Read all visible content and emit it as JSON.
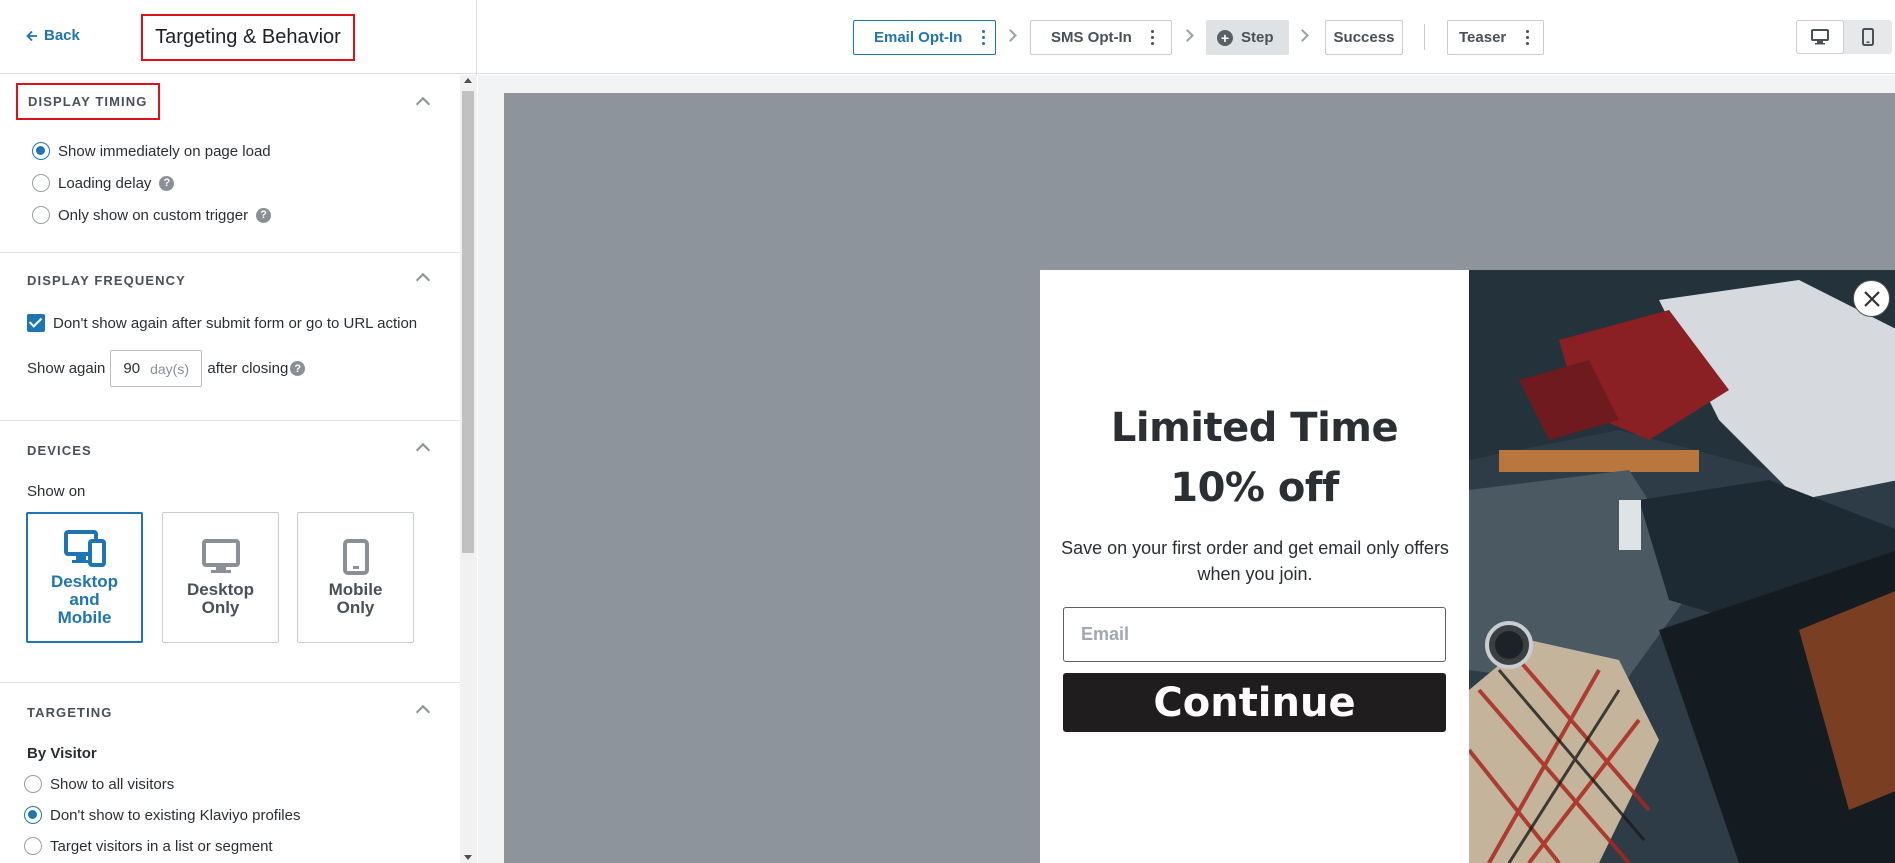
{
  "sidebar": {
    "back_label": "Back",
    "title": "Targeting & Behavior",
    "display_timing": {
      "heading": "DISPLAY TIMING",
      "options": [
        {
          "label": "Show immediately on page load",
          "selected": true
        },
        {
          "label": "Loading delay",
          "selected": false
        },
        {
          "label": "Only show on custom trigger",
          "selected": false
        }
      ]
    },
    "display_frequency": {
      "heading": "DISPLAY FREQUENCY",
      "checkbox_label": "Don't show again after submit form or go to URL action",
      "checked": true,
      "show_again_prefix": "Show again",
      "days_value": "90",
      "days_unit": "day(s)",
      "show_again_suffix": "after closing"
    },
    "devices": {
      "heading": "DEVICES",
      "show_on_label": "Show on",
      "cards": [
        {
          "label": "Desktop and Mobile",
          "selected": true
        },
        {
          "label": "Desktop Only",
          "selected": false
        },
        {
          "label": "Mobile Only",
          "selected": false
        }
      ]
    },
    "targeting": {
      "heading": "TARGETING",
      "by_visitor_label": "By Visitor",
      "options": [
        {
          "label": "Show to all visitors",
          "selected": false
        },
        {
          "label": "Don't show to existing Klaviyo profiles",
          "selected": true
        },
        {
          "label": "Target visitors in a list or segment",
          "selected": false
        }
      ]
    }
  },
  "topbar": {
    "steps": [
      {
        "label": "Email Opt-In",
        "state": "active"
      },
      {
        "label": "SMS Opt-In",
        "state": "normal"
      },
      {
        "label": "Step",
        "state": "add"
      },
      {
        "label": "Success",
        "state": "normal"
      },
      {
        "label": "Teaser",
        "state": "normal"
      }
    ],
    "view_modes": [
      "desktop",
      "mobile"
    ],
    "active_view": "desktop"
  },
  "popup": {
    "title_line1": "Limited Time",
    "title_line2": "10% off",
    "subtitle": "Save on your first order and get email only offers when you join.",
    "email_placeholder": "Email",
    "button_label": "Continue"
  },
  "colors": {
    "accent": "#1f74b4",
    "highlight_box": "#e0101a",
    "preview_bg": "#8d949c",
    "button_bg": "#201d1e"
  }
}
